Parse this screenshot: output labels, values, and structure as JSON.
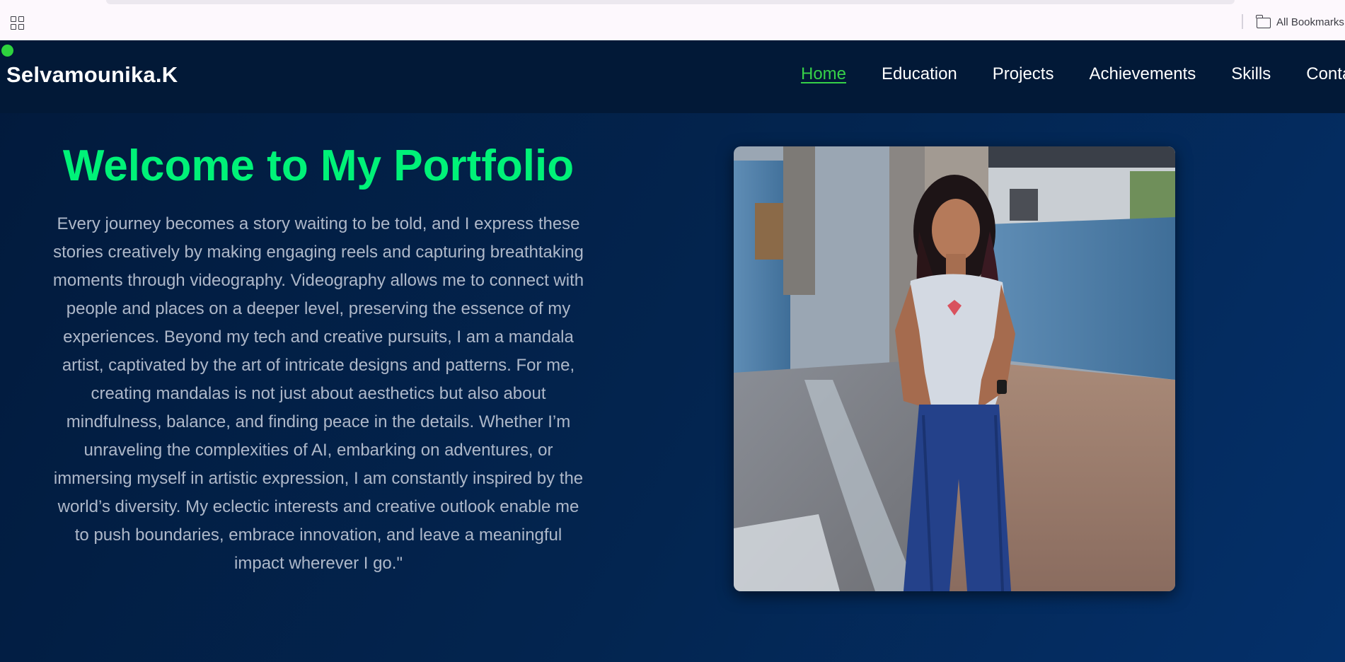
{
  "browser": {
    "apps_icon": "apps-grid-icon",
    "bookmarks_folder_icon": "folder-icon",
    "all_bookmarks_label": "All Bookmarks"
  },
  "nav": {
    "brand": "Selvamounika.K",
    "links": [
      {
        "label": "Home",
        "active": true
      },
      {
        "label": "Education"
      },
      {
        "label": "Projects"
      },
      {
        "label": "Achievements"
      },
      {
        "label": "Skills"
      },
      {
        "label": "Contact"
      }
    ],
    "active_color": "#36d148"
  },
  "hero": {
    "title": "Welcome to My Portfolio",
    "title_color": "#00f278",
    "paragraph": "Every journey becomes a story waiting to be told, and I express these stories creatively by making engaging reels and capturing breathtaking moments through videography. Videography allows me to connect with people and places on a deeper level, preserving the essence of my experiences. Beyond my tech and creative pursuits, I am a mandala artist, captivated by the art of intricate designs and patterns. For me, creating mandalas is not just about aesthetics but also about mindfulness, balance, and finding peace in the details. Whether I’m unraveling the complexities of AI, embarking on adventures, or immersing myself in artistic expression, I am constantly inspired by the world’s diversity. My eclectic interests and creative outlook enable me to push boundaries, embrace innovation, and leave a meaningful impact wherever I go.\""
  },
  "colors": {
    "page_background": "#032550",
    "navbar_background": "#021937",
    "status_dot": "#2ed33e"
  }
}
